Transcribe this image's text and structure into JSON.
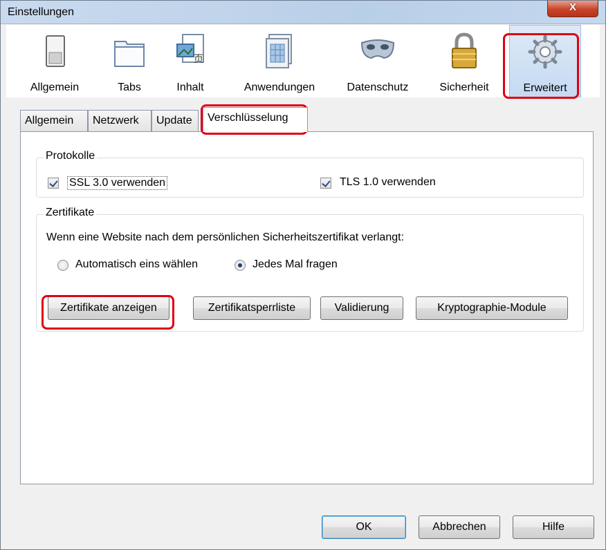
{
  "window": {
    "title": "Einstellungen",
    "close_label": "X"
  },
  "toolbar": {
    "items": [
      {
        "label": "Allgemein",
        "icon": "switch-icon"
      },
      {
        "label": "Tabs",
        "icon": "tabs-icon"
      },
      {
        "label": "Inhalt",
        "icon": "content-icon"
      },
      {
        "label": "Anwendungen",
        "icon": "applications-icon"
      },
      {
        "label": "Datenschutz",
        "icon": "mask-icon"
      },
      {
        "label": "Sicherheit",
        "icon": "padlock-icon"
      },
      {
        "label": "Erweitert",
        "icon": "gear-icon"
      }
    ],
    "selected": "Erweitert"
  },
  "tabs": {
    "items": [
      "Allgemein",
      "Netzwerk",
      "Update",
      "Verschlüsselung"
    ],
    "selected": "Verschlüsselung"
  },
  "protocols": {
    "title": "Protokolle",
    "ssl_label": "SSL 3.0 verwenden",
    "ssl_checked": true,
    "tls_label": "TLS 1.0 verwenden",
    "tls_checked": true
  },
  "certificates": {
    "title": "Zertifikate",
    "prompt": "Wenn eine Website nach dem persönlichen Sicherheitszertifikat verlangt:",
    "radio_auto": "Automatisch eins wählen",
    "radio_ask": "Jedes Mal fragen",
    "selected_radio": "Jedes Mal fragen",
    "buttons": {
      "view": "Zertifikate anzeigen",
      "revocation": "Zertifikatsperrliste",
      "validation": "Validierung",
      "crypto": "Kryptographie-Module"
    }
  },
  "footer": {
    "ok": "OK",
    "cancel": "Abbrechen",
    "help": "Hilfe"
  },
  "colors": {
    "highlight": "#e00010",
    "accent": "#3c7fb1"
  }
}
